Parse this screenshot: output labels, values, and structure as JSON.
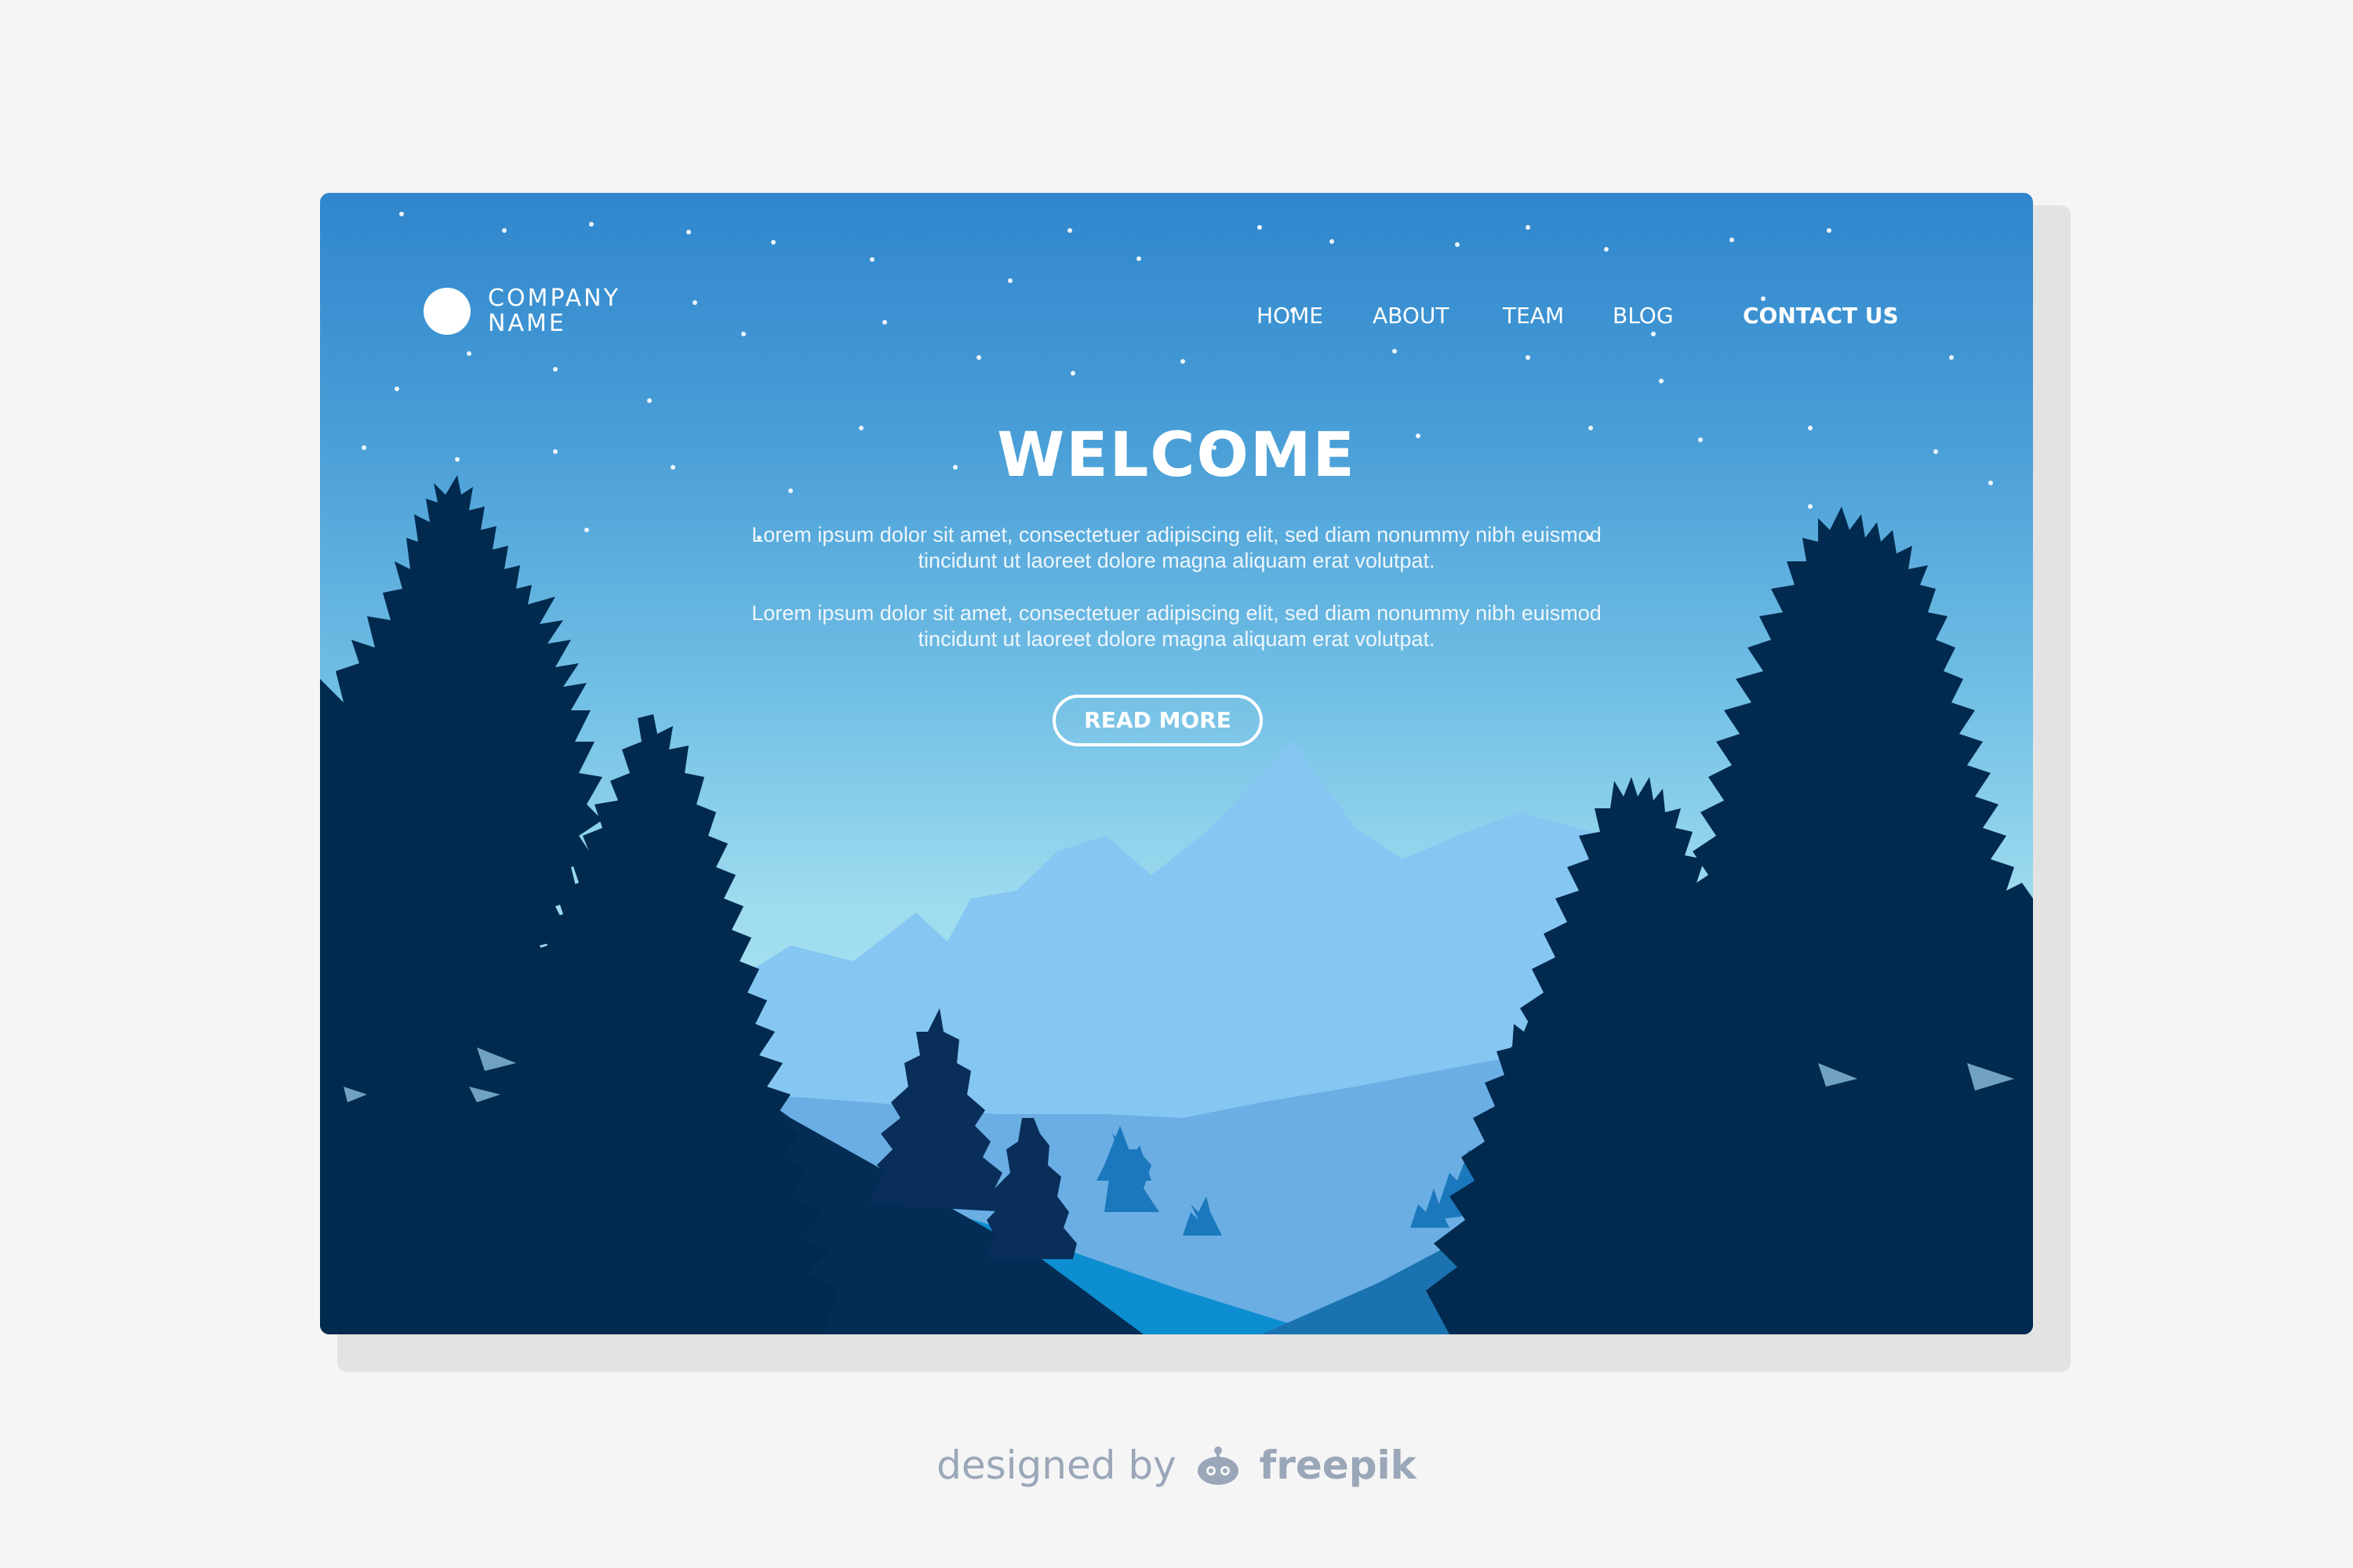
{
  "header": {
    "company_line1": "COMPANY",
    "company_line2": "NAME"
  },
  "nav": {
    "items": [
      "HOME",
      "ABOUT",
      "TEAM",
      "BLOG"
    ],
    "contact": "CONTACT US"
  },
  "hero": {
    "title": "WELCOME",
    "paragraph1_line1": "Lorem ipsum dolor sit amet, consectetuer adipiscing elit, sed diam nonummy nibh euismod",
    "paragraph1_line2": "tincidunt ut laoreet dolore magna aliquam erat volutpat.",
    "paragraph2_line1": "Lorem ipsum dolor sit amet, consectetuer adipiscing elit, sed diam nonummy nibh euismod",
    "paragraph2_line2": "tincidunt ut laoreet dolore magna aliquam erat volutpat.",
    "button": "READ MORE"
  },
  "footer": {
    "designed_by": "designed by",
    "brand": "freepik"
  },
  "icons": {
    "logo": "circle-logo-icon",
    "brand_logo": "freepik-robot-icon"
  },
  "colors": {
    "sky_top": "#2f86cc",
    "sky_bottom": "#a7e2f1",
    "far_mountain": "#86c6f2",
    "mid_hill": "#6aaee4",
    "near_hill": "#0d8ed0",
    "tree": "#022a4f",
    "page_background": "#f5f5f5"
  }
}
